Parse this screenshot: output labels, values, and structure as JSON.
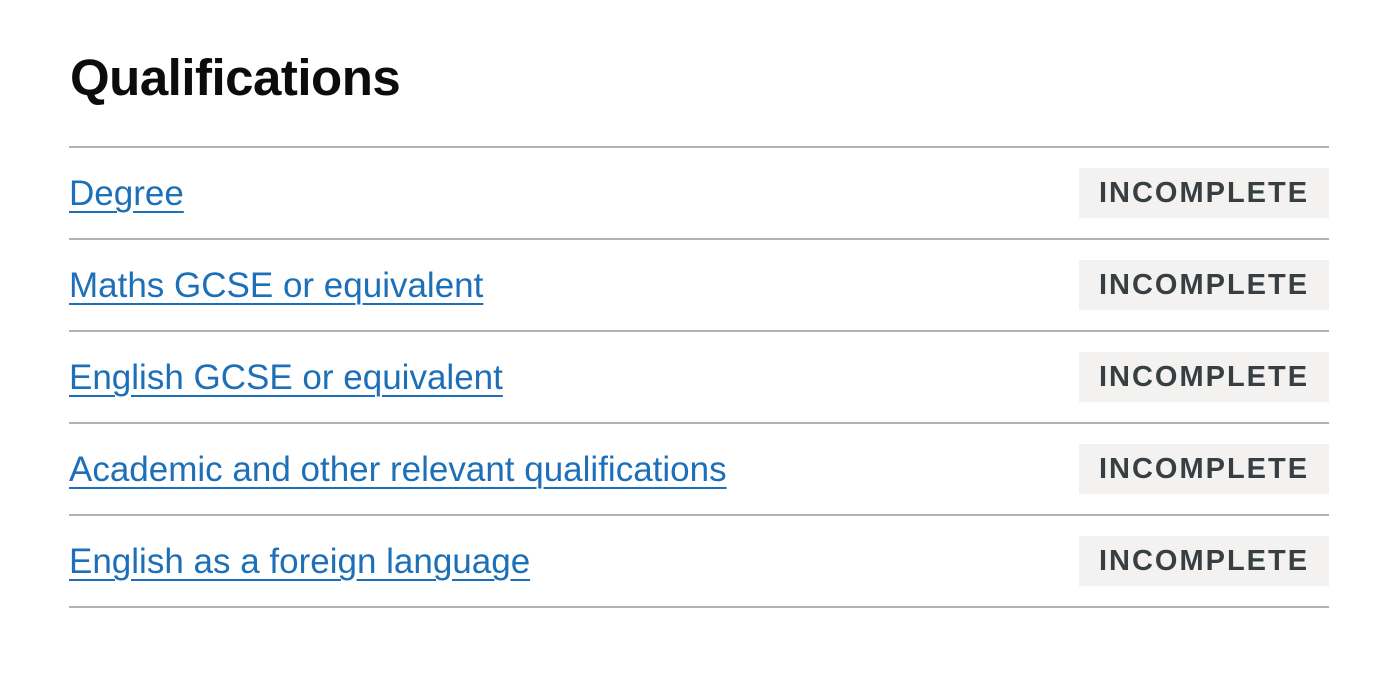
{
  "section": {
    "title": "Qualifications"
  },
  "tasks": [
    {
      "label": "Degree",
      "status": "INCOMPLETE"
    },
    {
      "label": "Maths GCSE or equivalent",
      "status": "INCOMPLETE"
    },
    {
      "label": "English GCSE or equivalent",
      "status": "INCOMPLETE"
    },
    {
      "label": "Academic and other relevant qualifications",
      "status": "INCOMPLETE"
    },
    {
      "label": "English as a foreign language",
      "status": "INCOMPLETE"
    }
  ],
  "colors": {
    "link": "#1d70b8",
    "text": "#0b0c0c",
    "divider": "#b1b4b6",
    "tag_background": "#f3f2f1",
    "tag_text": "#383f43"
  }
}
